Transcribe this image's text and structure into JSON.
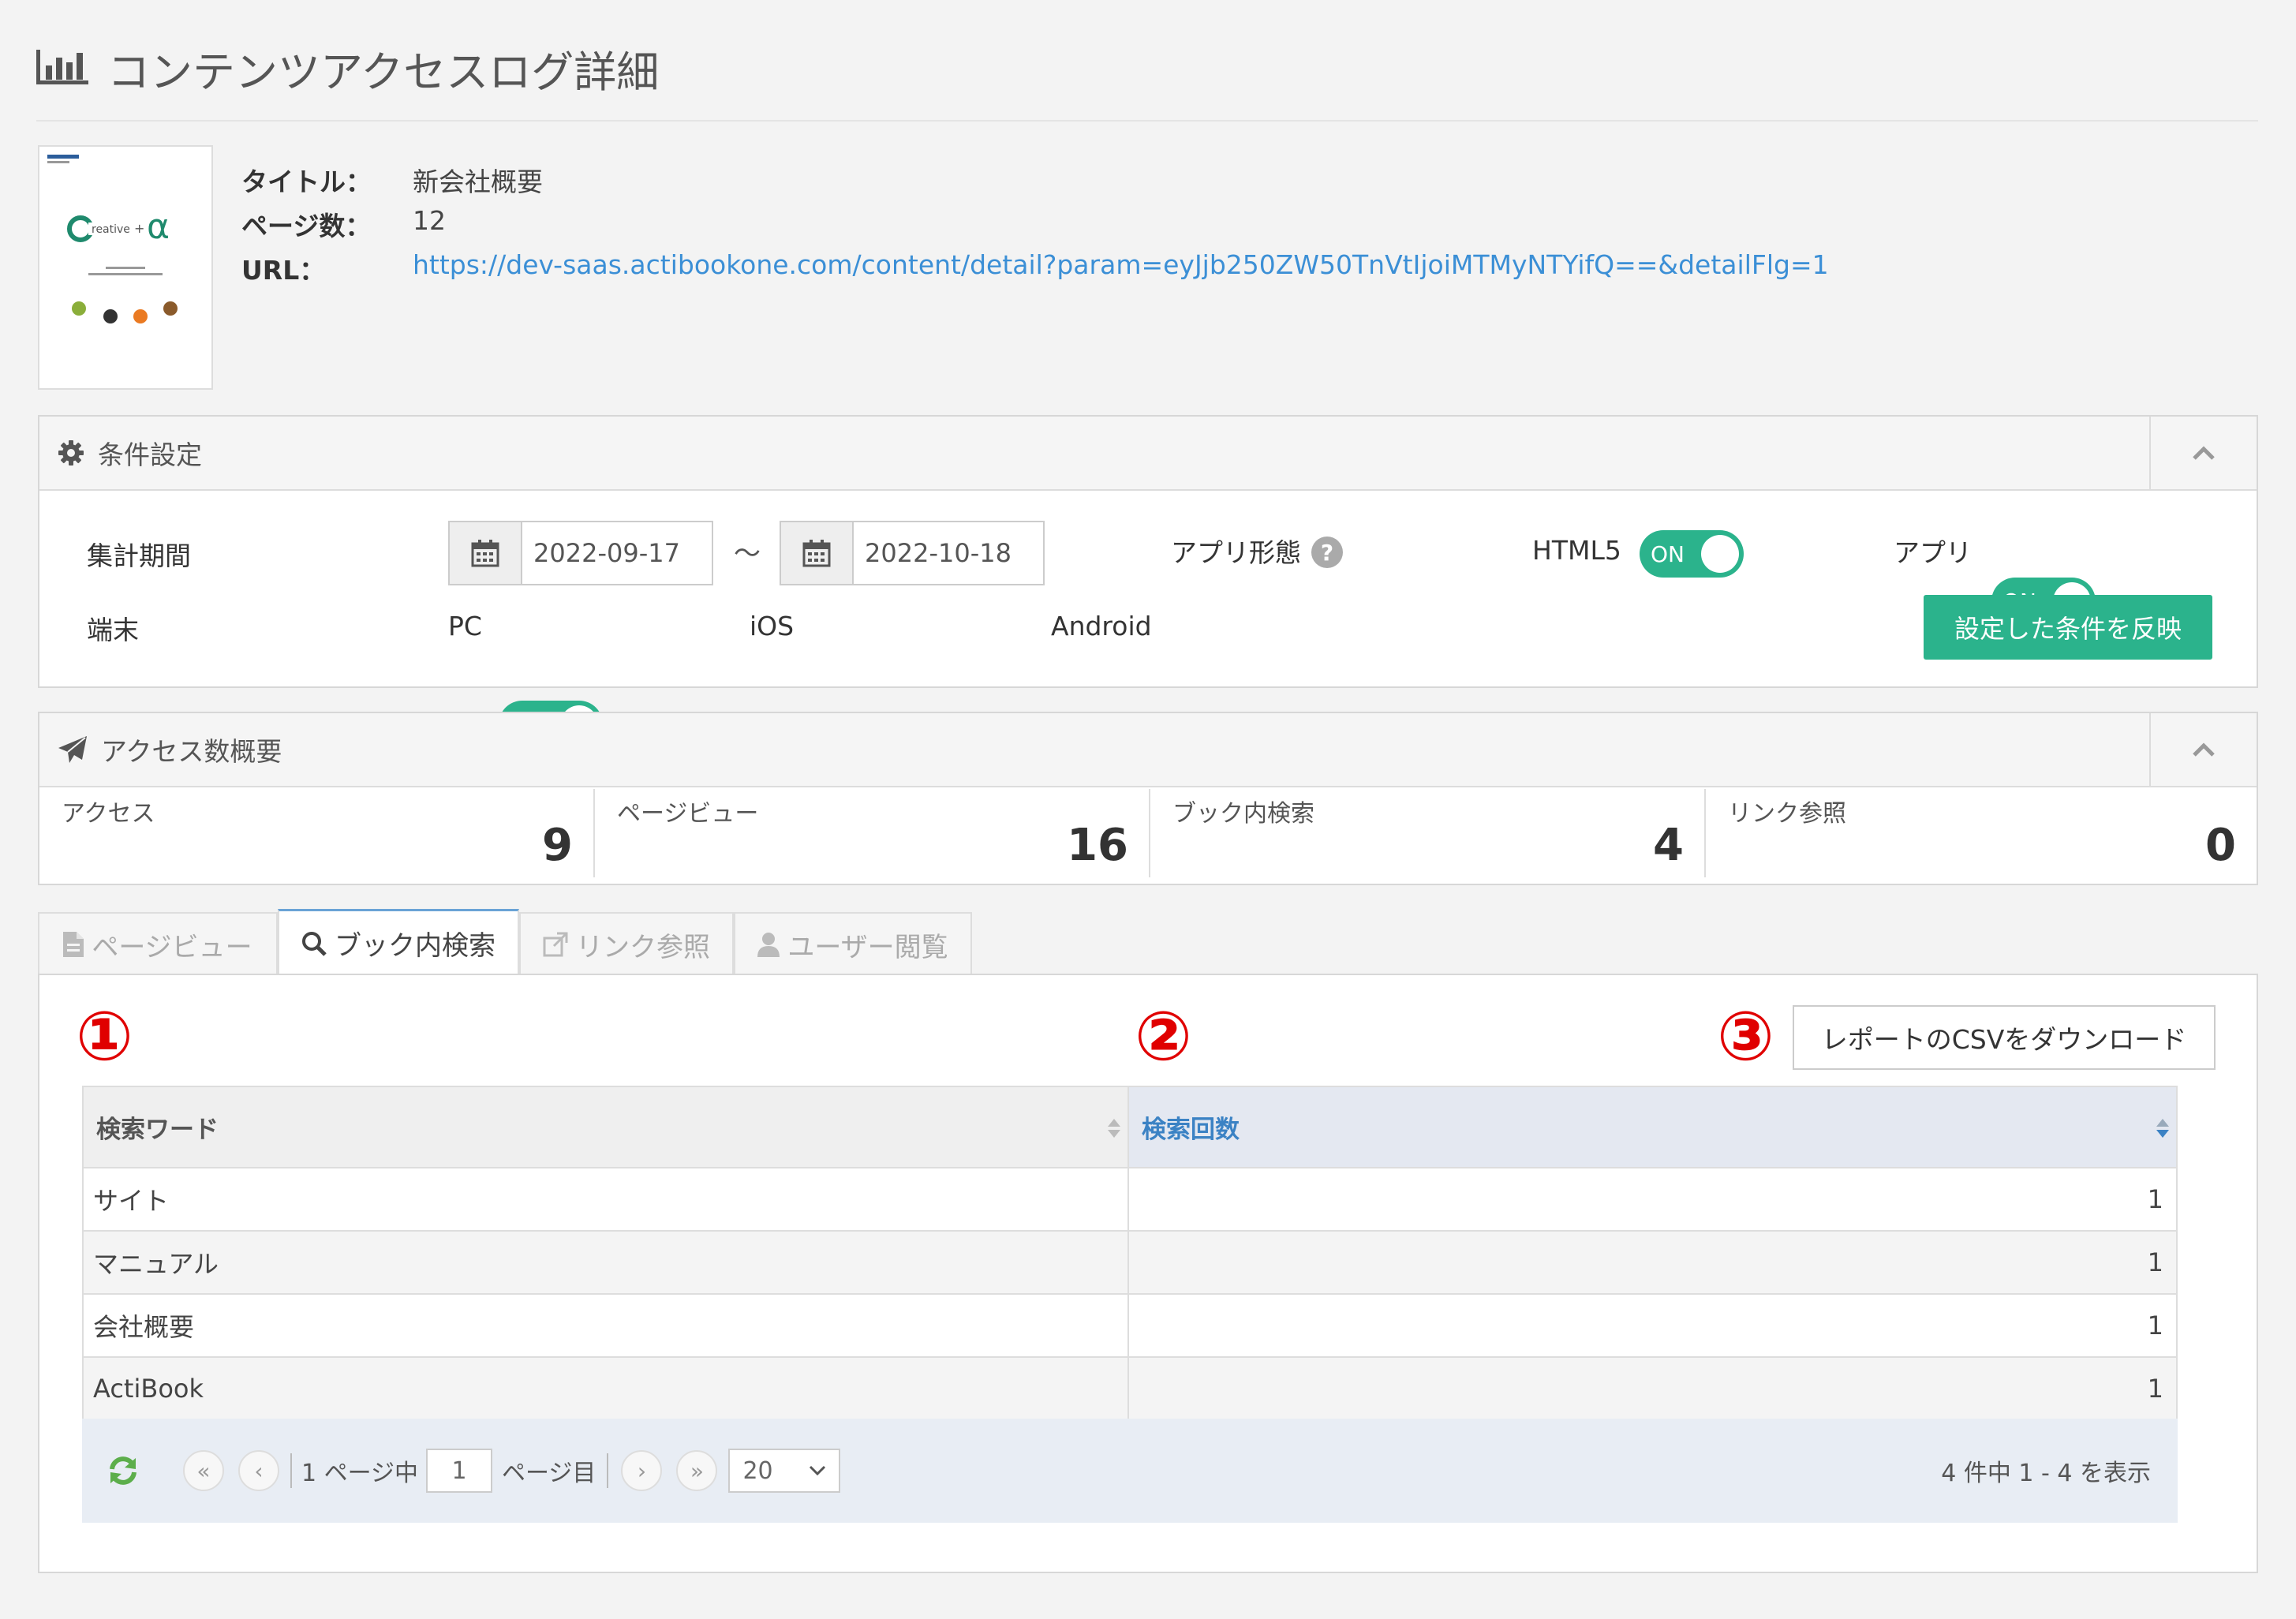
{
  "page": {
    "title": "コンテンツアクセスログ詳細",
    "icon": "bar-chart-icon"
  },
  "content": {
    "title_label": "タイトル：",
    "title_value": "新会社概要",
    "pages_label": "ページ数：",
    "pages_value": "12",
    "url_label": "URL：",
    "url_value": "https://dev-saas.actibookone.com/content/detail?param=eyJjb250ZW50TnVtIjoiMTMyNTYifQ==&detailFlg=1"
  },
  "conditions": {
    "header": "条件設定",
    "period_label": "集計期間",
    "date_from": "2022-09-17",
    "date_separator": "～",
    "date_to": "2022-10-18",
    "app_form_label": "アプリ形態",
    "help_glyph": "?",
    "html5_label": "HTML5",
    "app_label": "アプリ",
    "device_label": "端末",
    "pc_label": "PC",
    "ios_label": "iOS",
    "android_label": "Android",
    "toggle_on": "ON",
    "apply_button": "設定した条件を反映"
  },
  "summary": {
    "header": "アクセス数概要",
    "stats": [
      {
        "label": "アクセス",
        "value": "9"
      },
      {
        "label": "ページビュー",
        "value": "16"
      },
      {
        "label": "ブック内検索",
        "value": "4"
      },
      {
        "label": "リンク参照",
        "value": "0"
      }
    ]
  },
  "tabs": [
    {
      "label": "ページビュー",
      "icon": "document-icon",
      "active": false
    },
    {
      "label": "ブック内検索",
      "icon": "search-icon",
      "active": true
    },
    {
      "label": "リンク参照",
      "icon": "external-link-icon",
      "active": false
    },
    {
      "label": "ユーザー閲覧",
      "icon": "user-icon",
      "active": false
    }
  ],
  "markers": [
    "①",
    "②",
    "③"
  ],
  "csv_button": "レポートのCSVをダウンロード",
  "table": {
    "columns": [
      "検索ワード",
      "検索回数"
    ],
    "rows": [
      [
        "サイト",
        "1"
      ],
      [
        "マニュアル",
        "1"
      ],
      [
        "会社概要",
        "1"
      ],
      [
        "ActiBook",
        "1"
      ]
    ]
  },
  "pager": {
    "first": "«",
    "prev": "‹",
    "total_pages_text": "1 ページ中",
    "current_page": "1",
    "page_suffix": "ページ目",
    "next": "›",
    "last": "»",
    "page_size": "20",
    "summary": "4 件中 1 - 4 を表示"
  },
  "colors": {
    "accent_green": "#2bb38c",
    "link_blue": "#3b8fd6",
    "marker_red": "#e00000"
  }
}
